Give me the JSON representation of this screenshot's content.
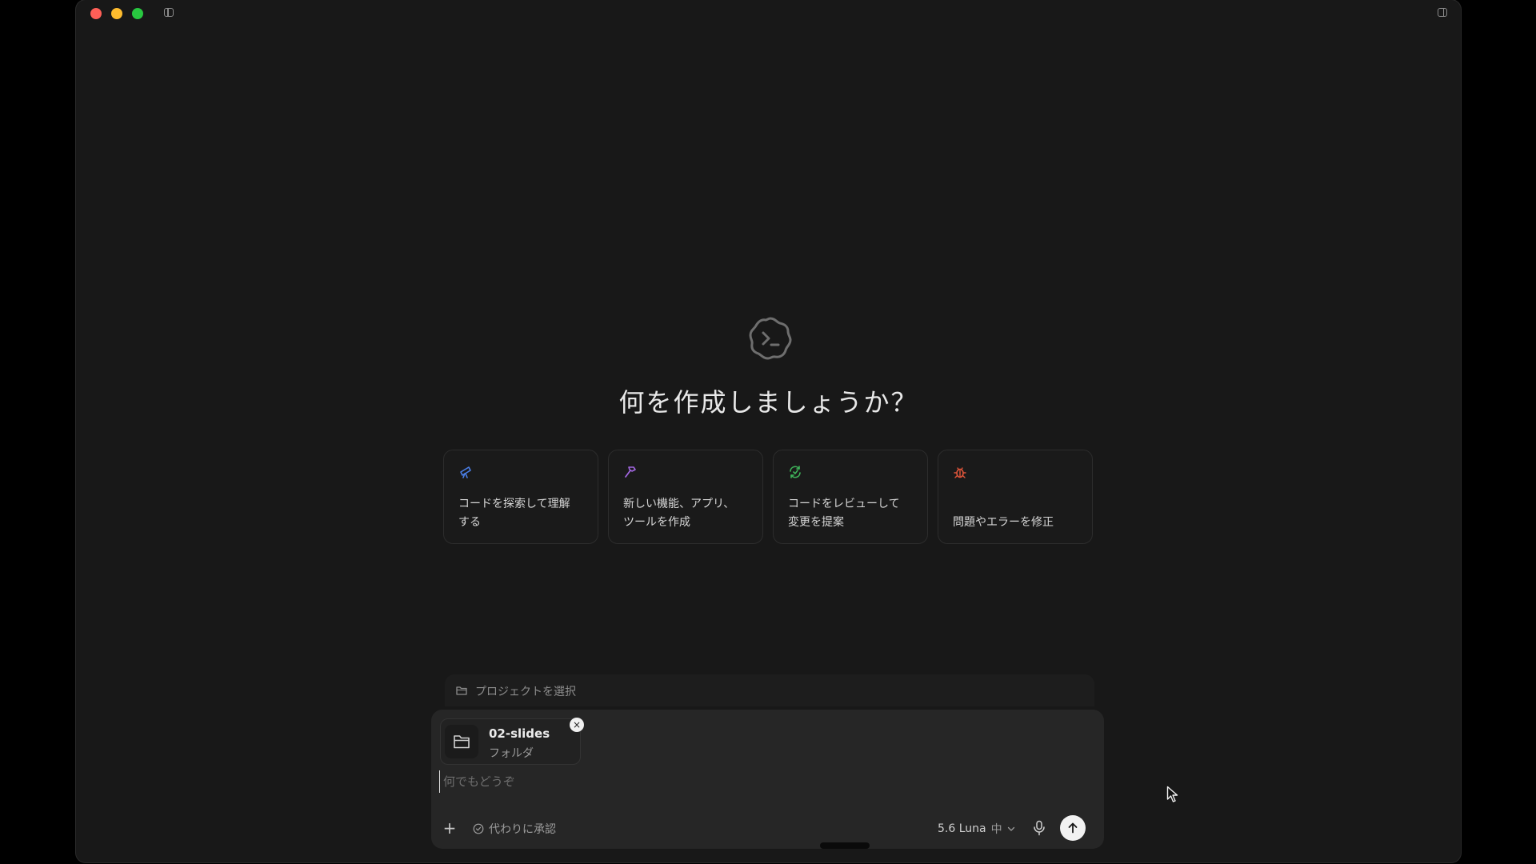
{
  "headline": "何を作成しましょうか？",
  "cards": [
    {
      "icon": "telescope-icon",
      "color": "#4a7fe8",
      "label": "コードを探索して理解\nする"
    },
    {
      "icon": "hammer-icon",
      "color": "#a266e0",
      "label": "新しい機能、アプリ、\nツールを作成"
    },
    {
      "icon": "review-cycle-icon",
      "color": "#3fb45a",
      "label": "コードをレビューして\n変更を提案"
    },
    {
      "icon": "bug-icon",
      "color": "#e0553a",
      "label": "問題やエラーを修正"
    }
  ],
  "project": {
    "label": "プロジェクトを選択"
  },
  "attachment": {
    "name": "02-slides",
    "type": "フォルダ",
    "close": "×"
  },
  "composer": {
    "placeholder": "何でもどうぞ",
    "plus": "+",
    "approve_label": "代わりに承認",
    "model_name": "5.6 Luna",
    "model_effort": "中"
  }
}
